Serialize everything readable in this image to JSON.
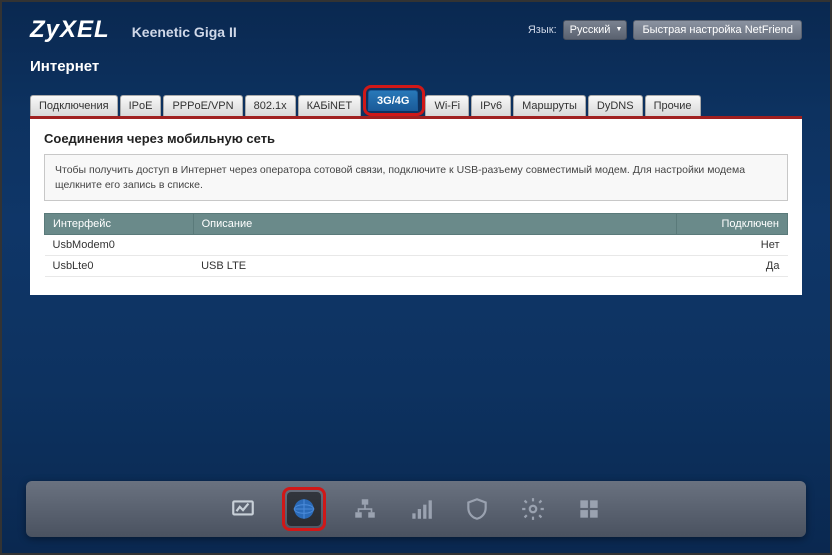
{
  "brand": "ZyXEL",
  "product": "Keenetic Giga II",
  "header": {
    "lang_label": "Язык:",
    "lang_value": "Русский",
    "quick_setup": "Быстрая настройка NetFriend"
  },
  "page_title": "Интернет",
  "tabs": [
    "Подключения",
    "IPoE",
    "PPPoE/VPN",
    "802.1x",
    "КАБiNET",
    "3G/4G",
    "Wi-Fi",
    "IPv6",
    "Маршруты",
    "DyDNS",
    "Прочие"
  ],
  "active_tab_index": 5,
  "section": {
    "title": "Соединения через мобильную сеть",
    "description": "Чтобы получить доступ в Интернет через оператора сотовой связи, подключите к USB-разъему совместимый модем. Для настройки модема щелкните его запись в списке."
  },
  "table": {
    "headers": [
      "Интерфейс",
      "Описание",
      "Подключен"
    ],
    "rows": [
      {
        "iface": "UsbModem0",
        "desc": "",
        "conn": "Нет"
      },
      {
        "iface": "UsbLte0",
        "desc": "USB LTE",
        "conn": "Да"
      }
    ]
  },
  "nav_icons": [
    "monitor",
    "globe",
    "network",
    "signal",
    "shield",
    "gear",
    "apps"
  ],
  "active_nav_index": 1
}
